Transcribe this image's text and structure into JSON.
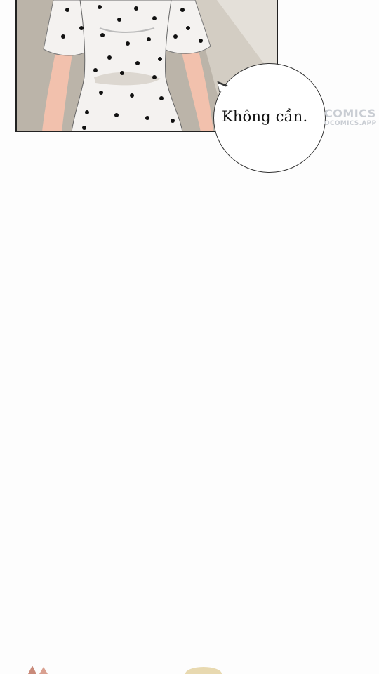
{
  "panel": {
    "image": "woman-in-white-polka-dot-dress",
    "colors": {
      "wall": "#b9b2a6",
      "dress": "#f4f2f0",
      "dots": "#111111",
      "skin": "#f2c1ad",
      "shadow": "#cfc9c0"
    }
  },
  "speech_bubble": {
    "text": "Không cần."
  },
  "watermark": {
    "line1": "COMICS",
    "line2": "OCOMICS.APP"
  }
}
